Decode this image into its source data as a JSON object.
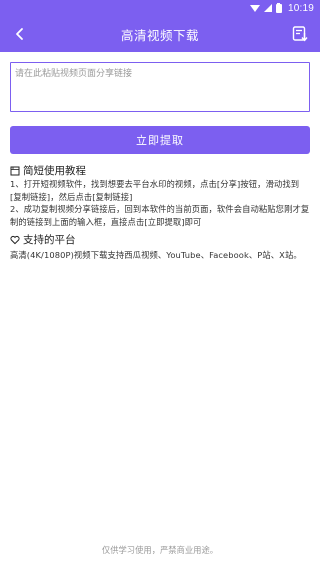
{
  "status_bar": {
    "time": "10:19"
  },
  "app_bar": {
    "title": "高清视频下载"
  },
  "input": {
    "placeholder": "请在此粘贴视频页面分享链接",
    "value": ""
  },
  "extract_button": {
    "label": "立即提取"
  },
  "tutorial": {
    "heading": "简短使用教程",
    "steps": [
      "1、打开短视频软件，找到想要去平台水印的视频，点击[分享]按钮，滑动找到[复制链接]，然后点击[复制链接]",
      "2、成功复制视频分享链接后，回到本软件的当前页面，软件会自动粘贴您刚才复制的链接到上面的输入框，直接点击[立即提取]即可"
    ]
  },
  "platforms": {
    "heading": "支持的平台",
    "text": "高清(4K/1080P)视频下载支持西瓜视频、YouTube、Facebook、P站、X站。"
  },
  "footer": {
    "text": "仅供学习使用，严禁商业用途。"
  },
  "colors": {
    "primary": "#7c5ff0",
    "white": "#ffffff",
    "muted": "#9a9a9a"
  },
  "icons": {
    "back": "back-arrow-icon",
    "action": "download-list-icon",
    "tutorial": "book-icon",
    "platforms": "heart-icon"
  }
}
